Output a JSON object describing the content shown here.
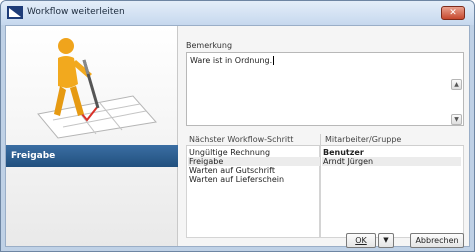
{
  "window": {
    "title": "Workflow weiterleiten",
    "close_glyph": "✕"
  },
  "left_panel": {
    "banner": "Freigabe"
  },
  "remark": {
    "label": "Bemerkung",
    "value": "Ware ist in Ordnung."
  },
  "steps": {
    "header": "Nächster Workflow-Schritt",
    "items": [
      "Ungültige Rechnung",
      "Freigabe",
      "Warten auf Gutschrift",
      "Warten auf Lieferschein"
    ],
    "selected_index": 1
  },
  "assignees": {
    "header": "Mitarbeiter/Gruppe",
    "group": "Benutzer",
    "items": [
      "Arndt Jürgen"
    ]
  },
  "buttons": {
    "ok_label": "OK",
    "dropdown_glyph": "▼",
    "cancel_label": "Abbrechen"
  },
  "scroll": {
    "up_glyph": "▲",
    "down_glyph": "▼"
  },
  "colors": {
    "banner": "#2a5a8a",
    "close": "#c6482e"
  }
}
